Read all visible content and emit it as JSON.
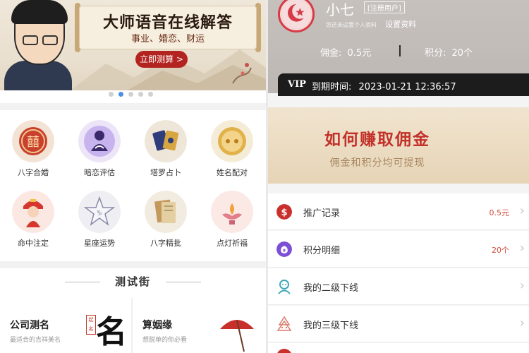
{
  "left": {
    "banner": {
      "title": "大师语音在线解答",
      "subtitle": "事业、婚恋、财运",
      "cta": "立即测算 >"
    },
    "carousel": {
      "count": 5,
      "active_index": 1
    },
    "services": [
      {
        "label": "八字合婚",
        "icon": "double-happiness-icon",
        "color": "#c9402f"
      },
      {
        "label": "暗恋评估",
        "icon": "girl-silhouette-icon",
        "color": "#8e6fd0"
      },
      {
        "label": "塔罗占卜",
        "icon": "tarot-cards-icon",
        "color": "#3e4c8c"
      },
      {
        "label": "姓名配对",
        "icon": "gold-coin-icon",
        "color": "#d49a2a"
      },
      {
        "label": "命中注定",
        "icon": "bride-doll-icon",
        "color": "#d6362d"
      },
      {
        "label": "星座运势",
        "icon": "star-icon",
        "color": "#8a8aa8"
      },
      {
        "label": "八字精批",
        "icon": "book-icon",
        "color": "#b68a4e"
      },
      {
        "label": "点灯祈福",
        "icon": "lotus-lamp-icon",
        "color": "#e27d8a"
      }
    ],
    "street": {
      "title": "测试街",
      "cards": [
        {
          "title": "公司测名",
          "subtitle": "最适合的吉祥美名",
          "art": "名",
          "seal": "起名"
        },
        {
          "title": "算姻缘",
          "subtitle": "想脱单的你必看"
        }
      ]
    }
  },
  "right": {
    "profile": {
      "name": "小七",
      "tag": "[注册用户]",
      "hint": "您还未设置个人资料",
      "settings_link": "设置资料",
      "commission_label": "佣金:",
      "commission_value": "0.5元",
      "points_label": "积分:",
      "points_value": "20个"
    },
    "vip": {
      "badge": "VIP",
      "expire_label": "到期时间:",
      "expire_value": "2023-01-21 12:36:57"
    },
    "earn": {
      "title": "如何赚取佣金",
      "subtitle": "佣金和积分均可提现"
    },
    "menu": [
      {
        "label": "推广记录",
        "value": "0.5元",
        "icon": "dollar-icon",
        "color": "#c9302c"
      },
      {
        "label": "积分明细",
        "value": "20个",
        "icon": "money-bag-icon",
        "color": "#7b4fd6"
      },
      {
        "label": "我的二级下线",
        "value": "",
        "icon": "person-outline-icon",
        "color": "#3fa7b8"
      },
      {
        "label": "我的三级下线",
        "value": "",
        "icon": "tree-icon",
        "color": "#d77a6a"
      }
    ]
  }
}
